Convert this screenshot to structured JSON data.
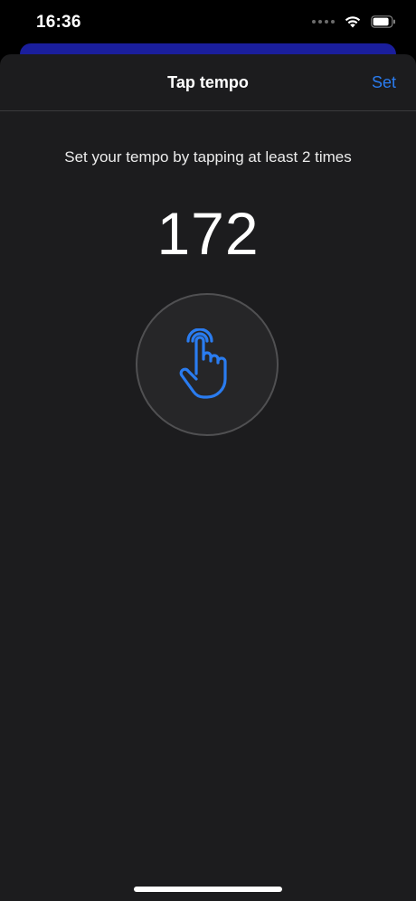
{
  "status_bar": {
    "time": "16:36",
    "signal_icon": "signal-dots-icon",
    "wifi_icon": "wifi-icon",
    "battery_icon": "battery-icon"
  },
  "sheet": {
    "title": "Tap tempo",
    "set_label": "Set",
    "instruction": "Set your tempo by tapping at least 2 times",
    "tempo": "172",
    "tap_icon": "tap-finger-icon"
  },
  "colors": {
    "accent": "#2a7cf0",
    "sheet_background": "#1c1c1e",
    "back_card": "#1a1e9c"
  }
}
